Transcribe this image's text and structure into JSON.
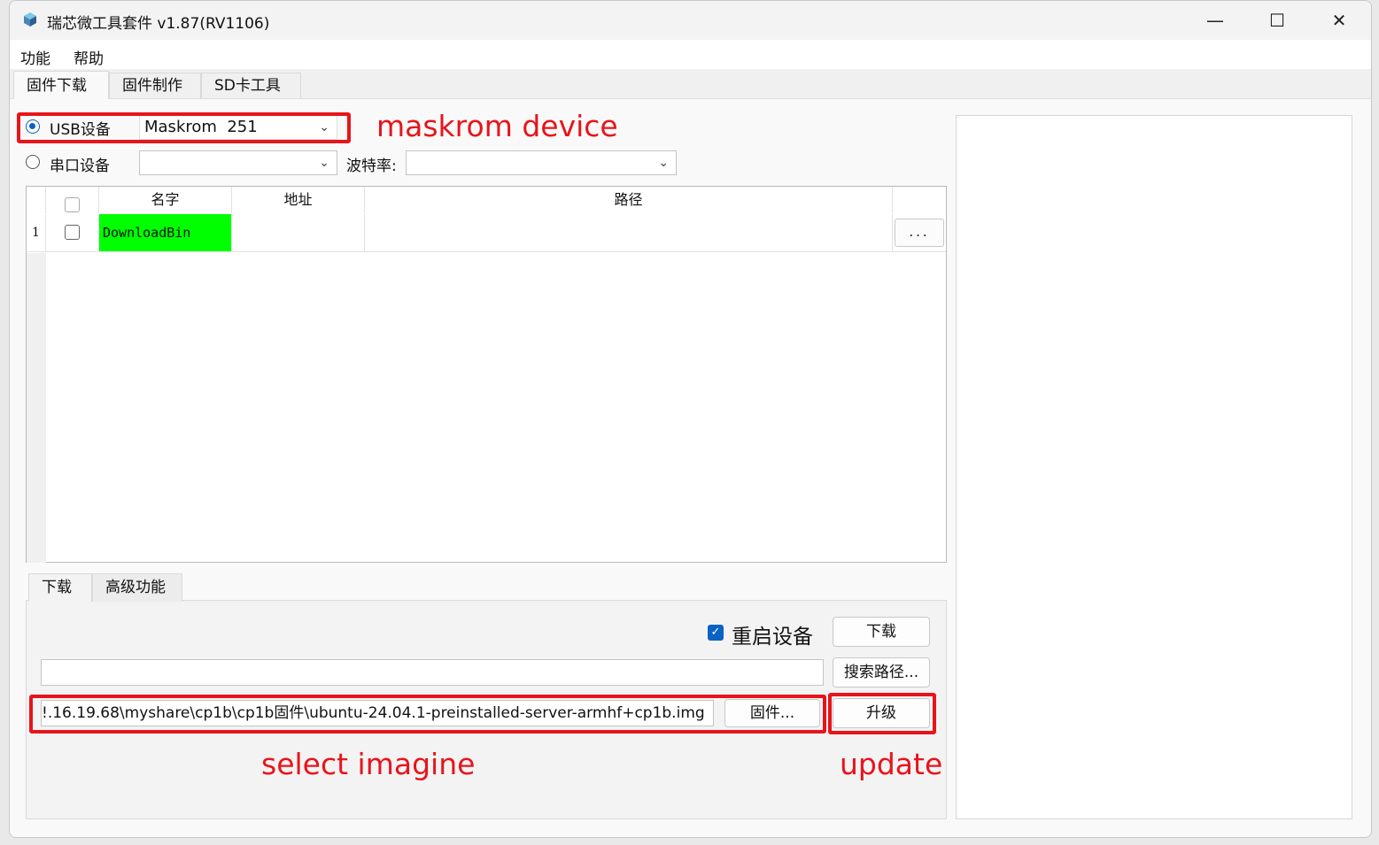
{
  "window": {
    "title": "瑞芯微工具套件 v1.87(RV1106)",
    "controls": {
      "minimize": "—",
      "maximize": "☐",
      "close": "✕"
    }
  },
  "menu": {
    "items": [
      "功能",
      "帮助"
    ]
  },
  "tabs": [
    "固件下载",
    "固件制作",
    "SD卡工具"
  ],
  "device": {
    "usb_label": "USB设备",
    "usb_selected": "Maskrom  251",
    "serial_label": "串口设备",
    "serial_selected": "",
    "baud_label": "波特率:",
    "baud_selected": ""
  },
  "table": {
    "headers": {
      "name": "名字",
      "address": "地址",
      "path": "路径"
    },
    "rows": [
      {
        "index": "1",
        "name": "DownloadBin",
        "address": "",
        "path": "",
        "browse": "..."
      }
    ]
  },
  "lower_tabs": [
    "下载",
    "高级功能"
  ],
  "download_panel": {
    "reboot_label": "重启设备",
    "reboot_checked": true,
    "download_button": "下载",
    "search_path_value": "",
    "search_path_button": "搜索路径...",
    "firmware_path": "!.16.19.68\\myshare\\cp1b\\cp1b固件\\ubuntu-24.04.1-preinstalled-server-armhf+cp1b.img",
    "firmware_button": "固件...",
    "upgrade_button": "升级"
  },
  "annotations": {
    "maskrom": "maskrom device",
    "select_image": "select imagine",
    "update": "update"
  },
  "colors": {
    "annotation_red": "#e8141b",
    "download_bin_green": "#00ff00",
    "accent_blue": "#0a62c4"
  }
}
